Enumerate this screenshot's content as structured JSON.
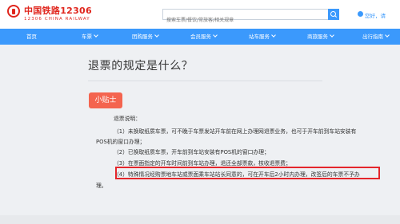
{
  "header": {
    "brand_cn": "中国铁路12306",
    "brand_en": "12306 CHINA RAILWAY",
    "search_placeholder": "搜索车票/餐饮/常旅客/相关规章",
    "welcome": "您好，请"
  },
  "nav": {
    "items": [
      {
        "label": "首页",
        "has_dropdown": false
      },
      {
        "label": "车票",
        "has_dropdown": true
      },
      {
        "label": "团购服务",
        "has_dropdown": true
      },
      {
        "label": "会员服务",
        "has_dropdown": true
      },
      {
        "label": "站车服务",
        "has_dropdown": true
      },
      {
        "label": "商旅服务",
        "has_dropdown": true
      },
      {
        "label": "出行指南",
        "has_dropdown": true
      }
    ]
  },
  "content": {
    "question": "退票的规定是什么？",
    "tip_label": "小贴士",
    "lines": [
      "退票说明：",
      "（1）未换取纸质车票，可不晚于车票发站开车前在网上办理网退票业务，也可于开车前到车站安装有",
      "POS机的窗口办理；",
      "（2）已换取纸质车票，开车前到车站安装有POS机的窗口办理；",
      "（3）在票面指定的开车时间前到车站办理，退还全部票款，核收退票费；",
      "（4）特殊情况经购票地车站或票面乘车站站长同意的，可在开车后2小时内办理，改签后的车票不予办",
      "理。"
    ]
  },
  "colors": {
    "brand_red": "#e0261d",
    "nav_blue": "#3b99fc",
    "tip_badge": "#f4644f",
    "highlight_border": "#e4262b"
  }
}
